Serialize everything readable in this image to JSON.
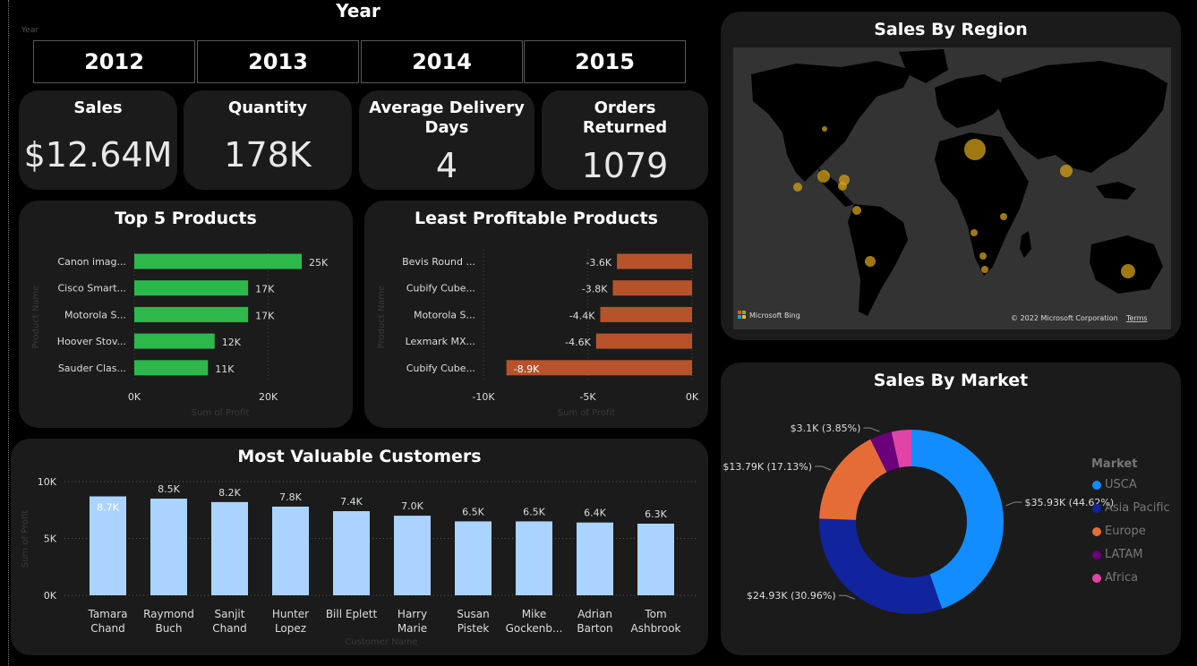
{
  "slicer": {
    "title": "Year",
    "field_label": "Year",
    "years": [
      "2012",
      "2013",
      "2014",
      "2015"
    ]
  },
  "kpis": [
    {
      "title": "Sales",
      "value": "$12.64M"
    },
    {
      "title": "Quantity",
      "value": "178K"
    },
    {
      "title": "Average Delivery Days",
      "value": "4"
    },
    {
      "title": "Orders Returned",
      "value": "1079"
    }
  ],
  "map": {
    "title": "Sales By Region",
    "bing_label": "Microsoft Bing",
    "copyright": "© 2022 Microsoft Corporation",
    "terms": "Terms"
  },
  "market_legend": {
    "title": "Market",
    "items": [
      {
        "name": "USCA",
        "color": "#118dff"
      },
      {
        "name": "Asia Pacific",
        "color": "#12239e"
      },
      {
        "name": "Europe",
        "color": "#e66c37"
      },
      {
        "name": "LATAM",
        "color": "#6b007b"
      },
      {
        "name": "Africa",
        "color": "#e044a7"
      }
    ]
  },
  "colors": {
    "top_bar": "#2db84b",
    "least_bar": "#b7532b",
    "customer_bar": "#aad4ff",
    "card_bg": "#1b1b1b"
  },
  "chart_data": [
    {
      "id": "top5",
      "type": "bar",
      "orientation": "horizontal",
      "title": "Top 5 Products",
      "xlabel": "Sum of Profit",
      "ylabel": "Product Name",
      "categories": [
        "Canon imag...",
        "Cisco Smart...",
        "Motorola S...",
        "Hoover Stov...",
        "Sauder Clas..."
      ],
      "values": [
        25000,
        17000,
        17000,
        12000,
        11000
      ],
      "data_labels": [
        "25K",
        "17K",
        "17K",
        "12K",
        "11K"
      ],
      "xlim": [
        0,
        25000
      ],
      "xticks": [
        {
          "value": 0,
          "label": "0K"
        },
        {
          "value": 20000,
          "label": "20K"
        }
      ]
    },
    {
      "id": "least",
      "type": "bar",
      "orientation": "horizontal",
      "title": "Least Profitable Products",
      "xlabel": "Sum of Profit",
      "ylabel": "Product Name",
      "categories": [
        "Bevis Round ...",
        "Cubify Cube...",
        "Motorola S...",
        "Lexmark MX...",
        "Cubify Cube..."
      ],
      "values": [
        -3600,
        -3800,
        -4400,
        -4600,
        -8900
      ],
      "data_labels": [
        "-3.6K",
        "-3.8K",
        "-4.4K",
        "-4.6K",
        "-8.9K"
      ],
      "xlim": [
        -10000,
        0
      ],
      "xticks": [
        {
          "value": -10000,
          "label": "-10K"
        },
        {
          "value": -5000,
          "label": "-5K"
        },
        {
          "value": 0,
          "label": "0K"
        }
      ]
    },
    {
      "id": "customers",
      "type": "bar",
      "orientation": "vertical",
      "title": "Most Valuable Customers",
      "xlabel": "Customer Name",
      "ylabel": "Sum of Profit",
      "categories": [
        [
          "Tamara",
          "Chand"
        ],
        [
          "Raymond",
          "Buch"
        ],
        [
          "Sanjit",
          "Chand"
        ],
        [
          "Hunter",
          "Lopez"
        ],
        [
          "Bill Eplett"
        ],
        [
          "Harry",
          "Marie"
        ],
        [
          "Susan",
          "Pistek"
        ],
        [
          "Mike",
          "Gockenb..."
        ],
        [
          "Adrian",
          "Barton"
        ],
        [
          "Tom",
          "Ashbrook"
        ]
      ],
      "values": [
        8700,
        8500,
        8200,
        7800,
        7400,
        7000,
        6500,
        6500,
        6400,
        6300
      ],
      "data_labels": [
        "8.7K",
        "8.5K",
        "8.2K",
        "7.8K",
        "7.4K",
        "7.0K",
        "6.5K",
        "6.5K",
        "6.4K",
        "6.3K"
      ],
      "ylim": [
        0,
        10000
      ],
      "yticks": [
        {
          "value": 0,
          "label": "0K"
        },
        {
          "value": 5000,
          "label": "5K"
        },
        {
          "value": 10000,
          "label": "10K"
        }
      ]
    },
    {
      "id": "market",
      "type": "pie",
      "donut": true,
      "title": "Sales By Market",
      "slices": [
        {
          "name": "USCA",
          "value": 35930,
          "label": "$35.93K (44.62%)",
          "color": "#118dff"
        },
        {
          "name": "Asia Pacific",
          "value": 24930,
          "label": "$24.93K (30.96%)",
          "color": "#12239e"
        },
        {
          "name": "Europe",
          "value": 13790,
          "label": "$13.79K (17.13%)",
          "color": "#e66c37"
        },
        {
          "name": "LATAM",
          "value": 3100,
          "label": "$3.1K (3.85%)",
          "color": "#6b007b"
        },
        {
          "name": "Africa",
          "value": 2800,
          "label": "",
          "color": "#e044a7"
        }
      ]
    }
  ]
}
